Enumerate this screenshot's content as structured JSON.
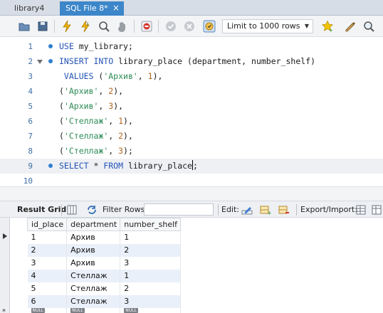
{
  "tabs": [
    {
      "label": "library4"
    },
    {
      "label": "SQL File 8*",
      "close": "×"
    }
  ],
  "toolbar": {
    "limit_label": "Limit to 1000 rows",
    "icons": [
      "folder-open-icon",
      "save-icon",
      "execute-icon",
      "execute-current-icon",
      "explain-icon",
      "stop-icon",
      "error-toggle-icon",
      "commit-icon",
      "rollback-icon",
      "autocommit-icon",
      "limit-dropdown",
      "bookmark-icon",
      "beautify-icon",
      "find-icon"
    ]
  },
  "editor": {
    "line_numbers": [
      "1",
      "2",
      "3",
      "4",
      "5",
      "6",
      "7",
      "8",
      "9",
      "10"
    ],
    "lines": [
      {
        "parts": [
          [
            "kw",
            "USE "
          ],
          [
            "pun",
            "my_library;"
          ]
        ]
      },
      {
        "parts": [
          [
            "kw",
            "INSERT INTO "
          ],
          [
            "pun",
            "library_place (department, number_shelf)"
          ]
        ]
      },
      {
        "parts": [
          [
            "kw",
            " VALUES "
          ],
          [
            "pun",
            "("
          ],
          [
            "str",
            "'Архив'"
          ],
          [
            "pun",
            ", "
          ],
          [
            "num",
            "1"
          ],
          [
            "pun",
            "),"
          ]
        ]
      },
      {
        "parts": [
          [
            "pun",
            "("
          ],
          [
            "str",
            "'Архив'"
          ],
          [
            "pun",
            ", "
          ],
          [
            "num",
            "2"
          ],
          [
            "pun",
            "),"
          ]
        ]
      },
      {
        "parts": [
          [
            "pun",
            "("
          ],
          [
            "str",
            "'Архив'"
          ],
          [
            "pun",
            ", "
          ],
          [
            "num",
            "3"
          ],
          [
            "pun",
            "),"
          ]
        ]
      },
      {
        "parts": [
          [
            "pun",
            "("
          ],
          [
            "str",
            "'Стеллаж'"
          ],
          [
            "pun",
            ", "
          ],
          [
            "num",
            "1"
          ],
          [
            "pun",
            "),"
          ]
        ]
      },
      {
        "parts": [
          [
            "pun",
            "("
          ],
          [
            "str",
            "'Стеллаж'"
          ],
          [
            "pun",
            ", "
          ],
          [
            "num",
            "2"
          ],
          [
            "pun",
            "),"
          ]
        ]
      },
      {
        "parts": [
          [
            "pun",
            "("
          ],
          [
            "str",
            "'Стеллаж'"
          ],
          [
            "pun",
            ", "
          ],
          [
            "num",
            "3"
          ],
          [
            "pun",
            ");"
          ]
        ]
      },
      {
        "parts": [
          [
            "kw",
            "SELECT "
          ],
          [
            "pun",
            "* "
          ],
          [
            "kw",
            "FROM "
          ],
          [
            "pun",
            "library_place"
          ],
          [
            "cursor",
            ""
          ],
          [
            "pun",
            ";"
          ]
        ]
      },
      {
        "parts": []
      }
    ]
  },
  "result_toolbar": {
    "result_grid": "Result Grid",
    "filter_rows": "Filter Rows:",
    "edit": "Edit:",
    "export_import": "Export/Import:"
  },
  "grid": {
    "columns": [
      "id_place",
      "department",
      "number_shelf"
    ],
    "rows": [
      [
        "1",
        "Архив",
        "1"
      ],
      [
        "2",
        "Архив",
        "2"
      ],
      [
        "3",
        "Архив",
        "3"
      ],
      [
        "4",
        "Стеллаж",
        "1"
      ],
      [
        "5",
        "Стеллаж",
        "2"
      ],
      [
        "6",
        "Стеллаж",
        "3"
      ]
    ],
    "null_label": "NULL",
    "row_marker": "*"
  },
  "colors": {
    "accent": "#3c86c9",
    "keyword": "#2453b6",
    "string": "#2e8b57",
    "number": "#b5651d",
    "alt_row": "#e9f0fa"
  }
}
